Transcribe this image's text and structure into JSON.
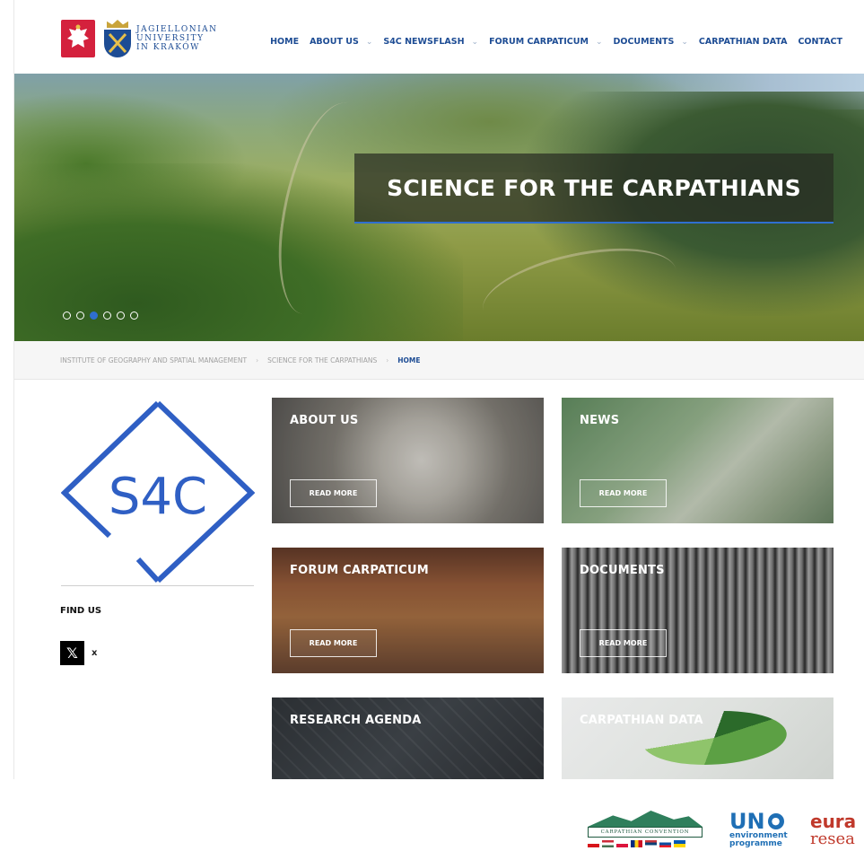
{
  "header": {
    "university_name": [
      "JAGIELLONIAN",
      "UNIVERSITY",
      "IN KRAKÓW"
    ],
    "nav": [
      {
        "label": "HOME",
        "dropdown": false
      },
      {
        "label": "ABOUT US",
        "dropdown": true
      },
      {
        "label": "S4C NEWSFLASH",
        "dropdown": true
      },
      {
        "label": "FORUM CARPATICUM",
        "dropdown": true
      },
      {
        "label": "DOCUMENTS",
        "dropdown": true
      },
      {
        "label": "CARPATHIAN DATA",
        "dropdown": false
      },
      {
        "label": "CONTACT",
        "dropdown": false
      }
    ]
  },
  "hero": {
    "title": "SCIENCE FOR THE CARPATHIANS",
    "slide_count": 6,
    "active_slide": 3
  },
  "breadcrumb": {
    "items": [
      "INSTITUTE OF GEOGRAPHY AND SPATIAL MANAGEMENT",
      "SCIENCE FOR THE CARPATHIANS"
    ],
    "current": "HOME"
  },
  "sidebar": {
    "logo_text": "S4C",
    "find_us": "FIND US",
    "social_label": "x"
  },
  "tiles": [
    {
      "title": "ABOUT US",
      "button": "READ MORE"
    },
    {
      "title": "NEWS",
      "button": "READ MORE"
    },
    {
      "title": "FORUM CARPATICUM",
      "button": "READ MORE"
    },
    {
      "title": "DOCUMENTS",
      "button": "READ MORE"
    },
    {
      "title": "RESEARCH AGENDA"
    },
    {
      "title": "CARPATHIAN DATA"
    }
  ],
  "footer": {
    "carpathian_convention": "CARPATHIAN CONVENTION",
    "un_env": {
      "big": "UN",
      "small": [
        "environment",
        "programme"
      ]
    },
    "eura": [
      "eura",
      "resea"
    ]
  },
  "colors": {
    "brand_blue": "#1d4c94",
    "accent_blue": "#2f6fd0",
    "polish_red": "#d4213d",
    "crest_gold": "#c9a43b"
  },
  "icons": {
    "social": "x-icon",
    "nav_dropdown": "chevron-down-icon"
  }
}
